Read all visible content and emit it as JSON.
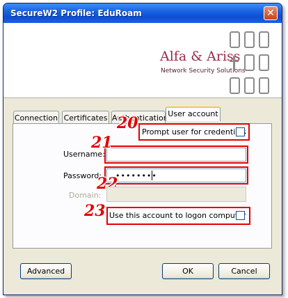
{
  "window": {
    "title": "SecureW2 Profile: EduRoam",
    "close_symbol": "✕"
  },
  "banner": {
    "brand_name": "Alfa & Ariss",
    "brand_tagline": "Network Security Solutions"
  },
  "tabs": [
    {
      "label": "Connection",
      "active": false
    },
    {
      "label": "Certificates",
      "active": false
    },
    {
      "label": "Authentication",
      "active": false
    },
    {
      "label": "User account",
      "active": true
    }
  ],
  "form": {
    "prompt_label": "Prompt user for credentials",
    "prompt_checked": false,
    "username_label": "Username:",
    "username_value": "",
    "password_label": "Password:",
    "password_mask": "••••••••",
    "domain_label": "Domain:",
    "domain_value": "",
    "logon_label": "Use this account to logon computer",
    "logon_checked": false
  },
  "annotations": {
    "prompt": "20",
    "username": "21",
    "password": "22",
    "logon": "23",
    "color": "#e00000"
  },
  "buttons": {
    "advanced": "Advanced",
    "ok": "OK",
    "cancel": "Cancel"
  }
}
